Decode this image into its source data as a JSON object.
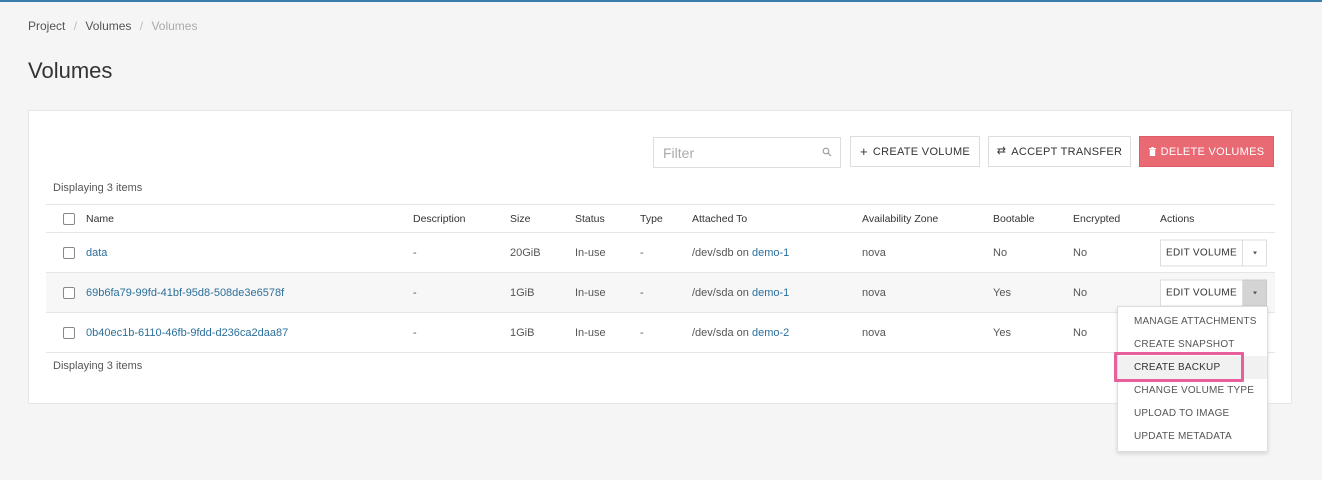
{
  "breadcrumb": {
    "items": [
      "Project",
      "Volumes"
    ],
    "current": "Volumes"
  },
  "page": {
    "title": "Volumes"
  },
  "toolbar": {
    "filter_placeholder": "Filter",
    "create_label": "CREATE VOLUME",
    "accept_label": "ACCEPT TRANSFER",
    "delete_label": "DELETE VOLUMES"
  },
  "summary": {
    "top": "Displaying 3 items",
    "bottom": "Displaying 3 items"
  },
  "table": {
    "headers": {
      "name": "Name",
      "description": "Description",
      "size": "Size",
      "status": "Status",
      "type": "Type",
      "attached": "Attached To",
      "zone": "Availability Zone",
      "bootable": "Bootable",
      "encrypted": "Encrypted",
      "actions": "Actions"
    },
    "rows": [
      {
        "name": "data",
        "description": "-",
        "size": "20GiB",
        "status": "In-use",
        "type": "-",
        "attached_dev": "/dev/sdb",
        "attached_on": "on",
        "attached_host": "demo-1",
        "zone": "nova",
        "bootable": "No",
        "encrypted": "No",
        "action": "EDIT VOLUME"
      },
      {
        "name": "69b6fa79-99fd-41bf-95d8-508de3e6578f",
        "description": "-",
        "size": "1GiB",
        "status": "In-use",
        "type": "-",
        "attached_dev": "/dev/sda",
        "attached_on": "on",
        "attached_host": "demo-1",
        "zone": "nova",
        "bootable": "Yes",
        "encrypted": "No",
        "action": "EDIT VOLUME"
      },
      {
        "name": "0b40ec1b-6110-46fb-9fdd-d236ca2daa87",
        "description": "-",
        "size": "1GiB",
        "status": "In-use",
        "type": "-",
        "attached_dev": "/dev/sda",
        "attached_on": "on",
        "attached_host": "demo-2",
        "zone": "nova",
        "bootable": "Yes",
        "encrypted": "No",
        "action": "EDIT VOLUME"
      }
    ]
  },
  "dropdown": {
    "items": [
      "MANAGE ATTACHMENTS",
      "CREATE SNAPSHOT",
      "CREATE BACKUP",
      "CHANGE VOLUME TYPE",
      "UPLOAD TO IMAGE",
      "UPDATE METADATA"
    ],
    "highlighted": "CREATE BACKUP"
  },
  "colors": {
    "accent": "#2a6f9b",
    "danger": "#ea6a74",
    "highlight": "#e8609b"
  },
  "icons": {
    "filter": "search-icon",
    "create": "plus-icon",
    "accept": "transfer-icon",
    "delete": "trash-icon",
    "caret": "caret-down-icon"
  }
}
